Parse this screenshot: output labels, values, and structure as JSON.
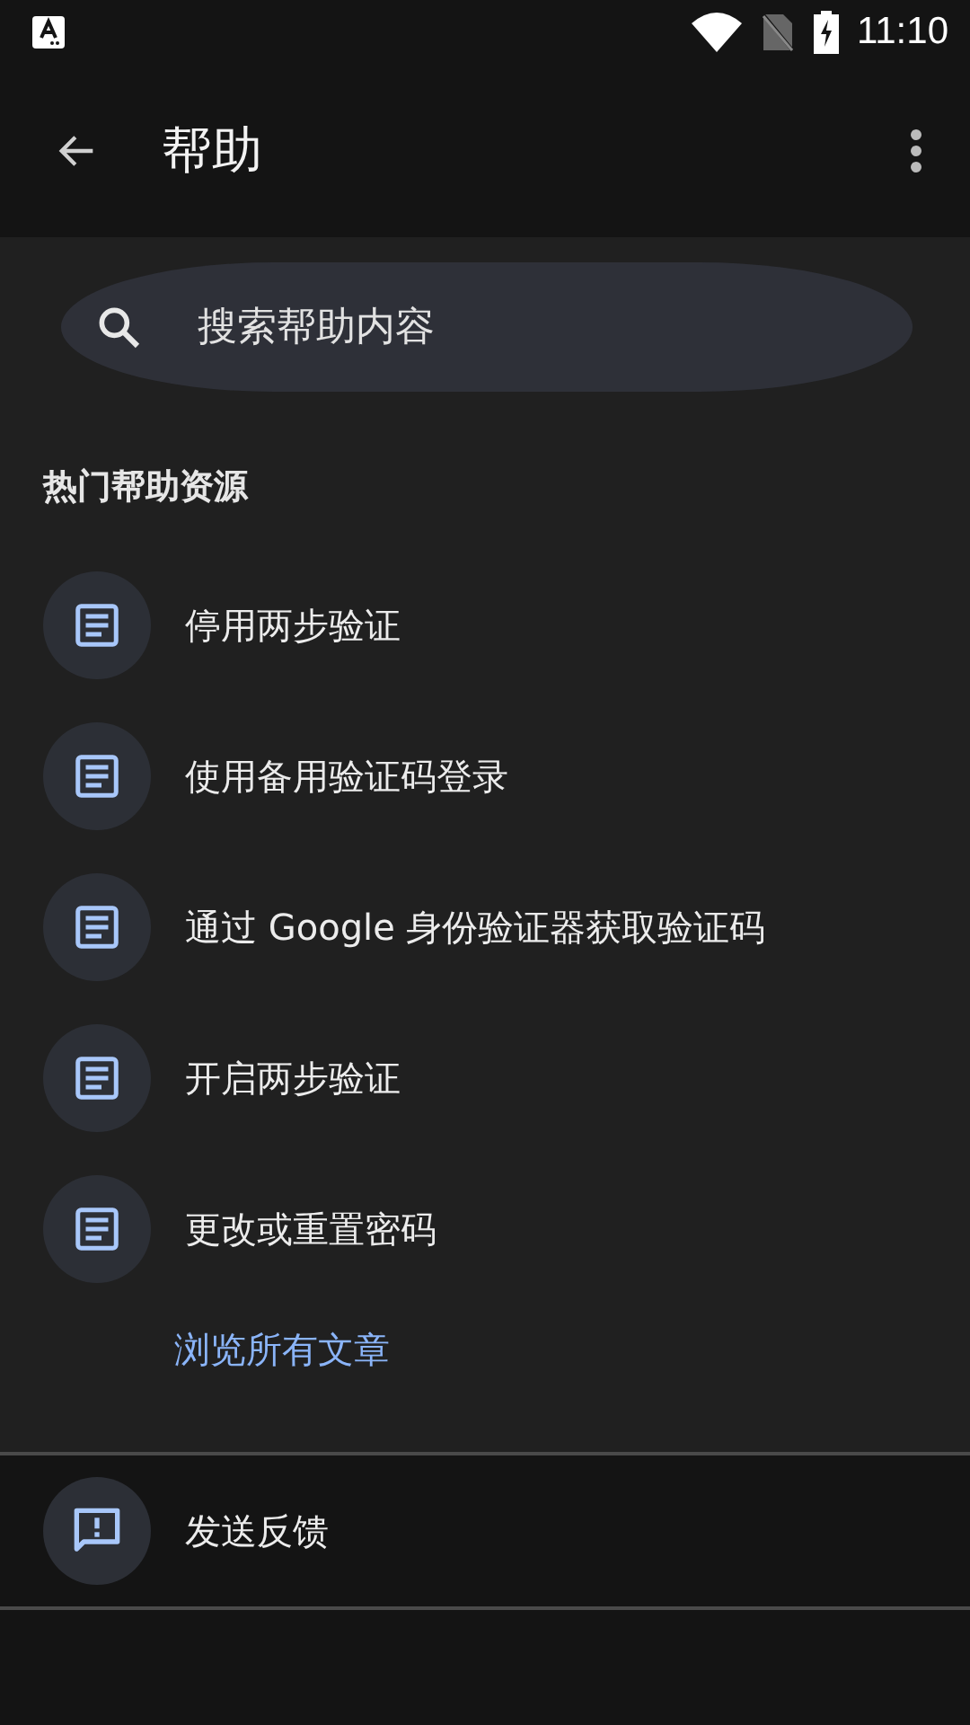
{
  "status_bar": {
    "time": "11:10"
  },
  "app_bar": {
    "title": "帮助"
  },
  "search": {
    "placeholder": "搜索帮助内容"
  },
  "section": {
    "title": "热门帮助资源",
    "articles": [
      {
        "label": "停用两步验证"
      },
      {
        "label": "使用备用验证码登录"
      },
      {
        "label": "通过 Google 身份验证器获取验证码"
      },
      {
        "label": "开启两步验证"
      },
      {
        "label": "更改或重置密码"
      }
    ],
    "browse_link": "浏览所有文章"
  },
  "feedback": {
    "label": "发送反馈"
  }
}
